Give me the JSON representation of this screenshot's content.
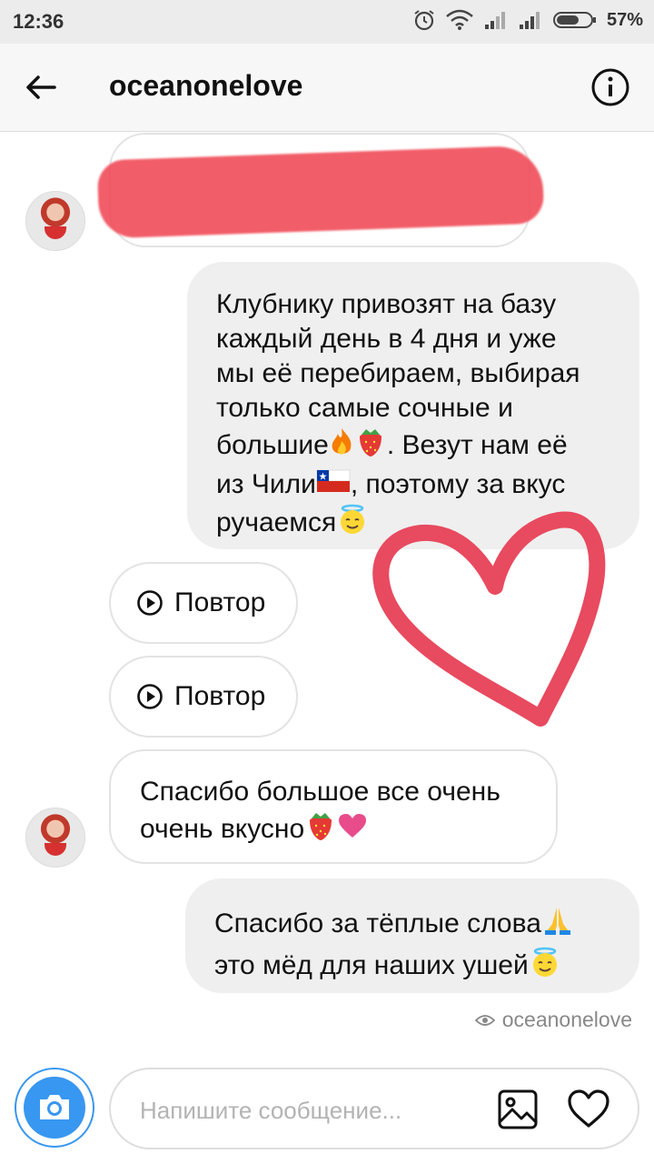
{
  "status_bar": {
    "time": "12:36",
    "battery": "57%"
  },
  "header": {
    "title": "oceanonelove"
  },
  "messages": [
    {
      "direction": "out",
      "lines": [
        "Клубнику привозят на базу",
        "каждый день в 4 дня и уже",
        "мы её перебираем, выбирая",
        "только самые сочные и",
        "большие",
        ". Везут нам её",
        "из Чили",
        ", поэтому за вкус",
        "ручаемся"
      ]
    },
    {
      "type": "replay",
      "label": "Повтор"
    },
    {
      "type": "replay",
      "label": "Повтор"
    },
    {
      "direction": "in",
      "lines": [
        "Спасибо большое все очень",
        "очень вкусно"
      ]
    },
    {
      "direction": "out",
      "lines": [
        "Спасибо за тёплые слова",
        "это мёд для наших ушей"
      ]
    }
  ],
  "seen_by": "oceanonelove",
  "composer": {
    "placeholder": "Напишите сообщение..."
  },
  "colors": {
    "accent": "#3897f0",
    "outgoing_bubble": "#efefef",
    "heart": "#e84a5f",
    "redaction": "#f0505c"
  },
  "icons": [
    "back-arrow-icon",
    "info-icon",
    "play-icon",
    "camera-icon",
    "gallery-icon",
    "heart-outline-icon",
    "eye-icon",
    "fire-emoji",
    "strawberry-emoji",
    "chile-flag-emoji",
    "halo-smile-emoji",
    "pink-heart-emoji",
    "pray-emoji"
  ]
}
